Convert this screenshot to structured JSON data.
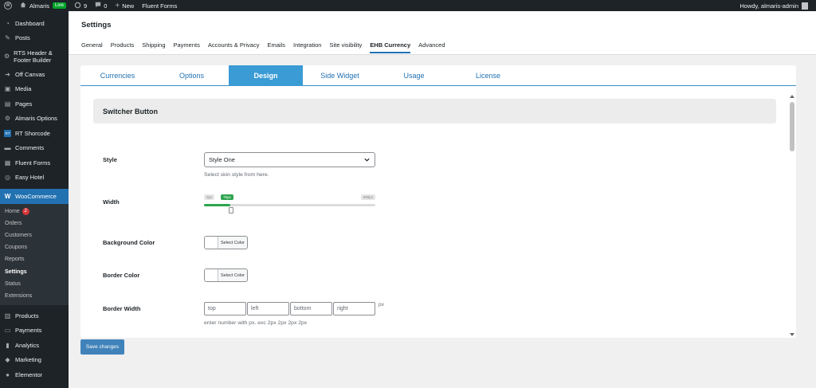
{
  "adminbar": {
    "site_name": "Almaris",
    "live_label": "Live",
    "updates_count": "9",
    "comments_count": "0",
    "new_label": "New",
    "fluent_forms": "Fluent Forms",
    "howdy": "Howdy, almaris-admin"
  },
  "sidebar": {
    "items": [
      {
        "label": "Dashboard",
        "icon": "dashboard-icon"
      },
      {
        "label": "Posts",
        "icon": "pin-icon"
      },
      {
        "label": "RTS Header & Footer Builder",
        "icon": "gear-icon"
      },
      {
        "label": "Off Canvas",
        "icon": "arrow-icon"
      },
      {
        "label": "Media",
        "icon": "media-icon"
      },
      {
        "label": "Pages",
        "icon": "pages-icon"
      },
      {
        "label": "Almaris Options",
        "icon": "gear-icon"
      },
      {
        "label": "RT Shorcode",
        "icon": "rt-icon",
        "icon_text": "RT"
      },
      {
        "label": "Comments",
        "icon": "comment-icon"
      },
      {
        "label": "Fluent Forms",
        "icon": "forms-icon"
      },
      {
        "label": "Easy Hotel",
        "icon": "hotel-icon"
      }
    ],
    "woocommerce": {
      "label": "WooCommerce",
      "icon_text": "W"
    },
    "submenu": [
      {
        "label": "Home",
        "badge": "2"
      },
      {
        "label": "Orders"
      },
      {
        "label": "Customers"
      },
      {
        "label": "Coupons"
      },
      {
        "label": "Reports"
      },
      {
        "label": "Settings"
      },
      {
        "label": "Status"
      },
      {
        "label": "Extensions"
      }
    ],
    "bottom_items": [
      {
        "label": "Products",
        "icon": "products-icon"
      },
      {
        "label": "Payments",
        "icon": "payments-icon"
      },
      {
        "label": "Analytics",
        "icon": "analytics-icon"
      },
      {
        "label": "Marketing",
        "icon": "marketing-icon"
      },
      {
        "label": "Elementor",
        "icon": "elementor-icon"
      }
    ]
  },
  "settings": {
    "title": "Settings",
    "tabs": [
      "General",
      "Products",
      "Shipping",
      "Payments",
      "Accounts & Privacy",
      "Emails",
      "Integration",
      "Site visibility",
      "EHB Currency",
      "Advanced"
    ],
    "active_tab": "EHB Currency"
  },
  "inner_tabs": [
    "Currencies",
    "Options",
    "Design",
    "Side Widget",
    "Usage",
    "License"
  ],
  "active_inner_tab": "Design",
  "section": {
    "title": "Switcher Button",
    "style": {
      "label": "Style",
      "value": "Style One",
      "help": "Select skin style from here."
    },
    "width": {
      "label": "Width",
      "min": "0px",
      "max": "999px",
      "value": "75px",
      "fraction": 0.14
    },
    "background_color": {
      "label": "Background Color",
      "button": "Select Color"
    },
    "border_color": {
      "label": "Border Color",
      "button": "Select Color"
    },
    "border_width": {
      "label": "Border Width",
      "placeholders": [
        "top",
        "left",
        "bottom",
        "right"
      ],
      "unit": "px",
      "help": "enter number with px. exc 2px 2px 2px 2px"
    }
  },
  "save_label": "Save changes",
  "colors": {
    "admin_dark": "#1d2327",
    "accent_blue": "#2271b1",
    "tab_blue": "#3a9bd5",
    "slider_green": "#2ea44f"
  }
}
